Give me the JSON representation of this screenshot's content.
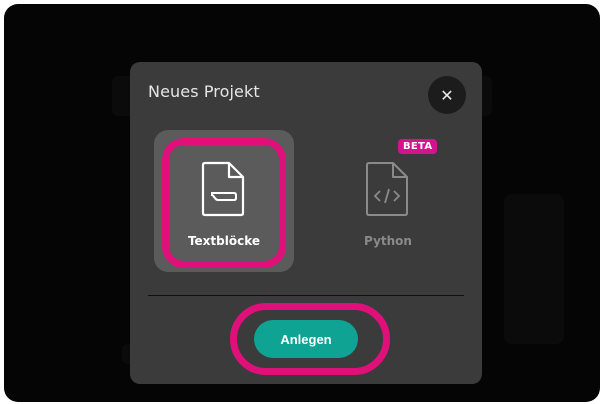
{
  "modal": {
    "title": "Neues Projekt",
    "close_icon_glyph": "✕",
    "options": [
      {
        "label": "Textblöcke",
        "icon": "text-blocks-file-icon",
        "selected": true
      },
      {
        "label": "Python",
        "icon": "code-file-icon",
        "selected": false,
        "badge": "BETA"
      }
    ],
    "create_label": "Anlegen"
  },
  "colors": {
    "highlight": "#e0107a",
    "accent": "#0fa394",
    "badge": "#d4148f",
    "modal_bg": "#3b3b3b",
    "selected_card_bg": "#5b5b5b"
  }
}
